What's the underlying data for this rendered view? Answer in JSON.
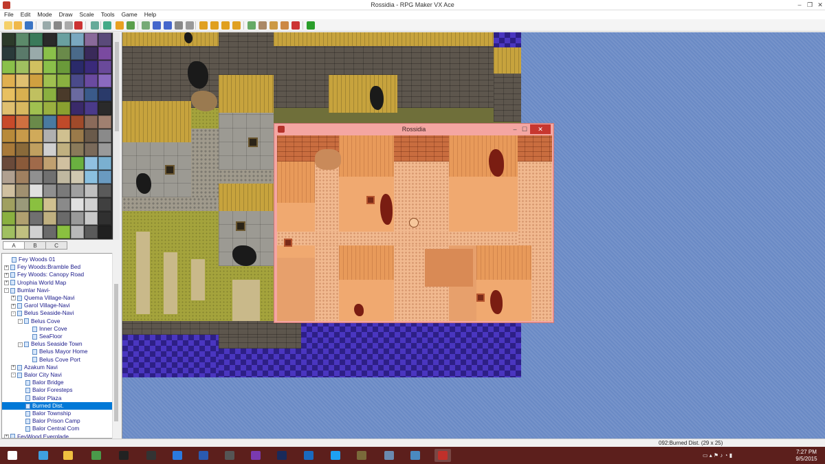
{
  "window": {
    "title": "Rossidia - RPG Maker VX Ace",
    "min_icon": "minimize-icon",
    "max_icon": "restore-icon",
    "close_icon": "close-icon"
  },
  "menu": [
    "File",
    "Edit",
    "Mode",
    "Draw",
    "Scale",
    "Tools",
    "Game",
    "Help"
  ],
  "toolbar_icons": [
    "new-project-icon",
    "open-project-icon",
    "save-project-icon",
    "cut-icon",
    "copy-icon",
    "paste-icon",
    "delete-icon",
    "undo-icon",
    "layer-map-icon",
    "layer-event-icon",
    "region-icon",
    "pencil-icon",
    "rectangle-icon",
    "ellipse-icon",
    "flood-fill-icon",
    "shadow-pen-icon",
    "zoom-1-1-icon",
    "zoom-1-2-icon",
    "zoom-1-4-icon",
    "zoom-1-8-icon",
    "database-icon",
    "resource-manager-icon",
    "script-editor-icon",
    "sound-test-icon",
    "character-generator-icon",
    "playtest-icon"
  ],
  "tileset_tabs": [
    "A",
    "B",
    "C"
  ],
  "active_tab": "A",
  "map_tree": [
    {
      "label": "Fey Woods 01",
      "depth": 0,
      "expander": ""
    },
    {
      "label": "Fey Woods:Bramble Bed",
      "depth": 0,
      "expander": "+"
    },
    {
      "label": "Fey Woods: Canopy Road",
      "depth": 0,
      "expander": "+"
    },
    {
      "label": "Urophia World Map",
      "depth": 0,
      "expander": "+"
    },
    {
      "label": "Bumlar Navi-",
      "depth": 0,
      "expander": "-"
    },
    {
      "label": "Quema Village-Navi",
      "depth": 1,
      "expander": "+"
    },
    {
      "label": "Garol Village-Navi",
      "depth": 1,
      "expander": "+"
    },
    {
      "label": "Belus Seaside-Navi",
      "depth": 1,
      "expander": "-"
    },
    {
      "label": "Belus Cove",
      "depth": 2,
      "expander": "-"
    },
    {
      "label": "Inner Cove",
      "depth": 3,
      "expander": ""
    },
    {
      "label": "SeaFloor",
      "depth": 3,
      "expander": ""
    },
    {
      "label": "Belus Seaside Town",
      "depth": 2,
      "expander": "-"
    },
    {
      "label": "Belus Mayor Home",
      "depth": 3,
      "expander": ""
    },
    {
      "label": "Belus Cove Port",
      "depth": 3,
      "expander": ""
    },
    {
      "label": "Azakum Navi",
      "depth": 1,
      "expander": "+"
    },
    {
      "label": "Balor City Navi",
      "depth": 1,
      "expander": "-"
    },
    {
      "label": "Balor Bridge",
      "depth": 2,
      "expander": ""
    },
    {
      "label": "Balor Foresteps",
      "depth": 2,
      "expander": ""
    },
    {
      "label": "Balor Plaza",
      "depth": 2,
      "expander": ""
    },
    {
      "label": "Burned Dist.",
      "depth": 2,
      "expander": "",
      "selected": true
    },
    {
      "label": "Balor Township",
      "depth": 2,
      "expander": ""
    },
    {
      "label": "Balor Prison Camp",
      "depth": 2,
      "expander": ""
    },
    {
      "label": "Balor Central Com",
      "depth": 2,
      "expander": ""
    },
    {
      "label": "FeyWood Everglade",
      "depth": 0,
      "expander": "+"
    }
  ],
  "game_window": {
    "title": "Rossidia",
    "min_icon": "minimize-icon",
    "max_icon": "maximize-icon",
    "close_label": "✕"
  },
  "status": "092:Burned Dist. (29 x 25)",
  "taskbar": {
    "apps": [
      "windows-start-icon",
      "internet-explorer-icon",
      "file-explorer-icon",
      "chrome-icon",
      "tsw-icon",
      "app-icon",
      "dropbox-icon",
      "word-icon",
      "app-settings-icon",
      "onenote-icon",
      "photoshop-icon",
      "app-a-icon",
      "twitter-icon",
      "app-tree-icon",
      "app-photos-icon",
      "app-paint-icon",
      "rpg-maker-icon"
    ],
    "clock_time": "7:27 PM",
    "clock_date": "9/5/2015"
  },
  "colors": {
    "taskbar": "#5c1f1c",
    "selection": "#0078d7",
    "map_background": "#6a8ac5",
    "game_window_frame": "#f4a6a2"
  }
}
